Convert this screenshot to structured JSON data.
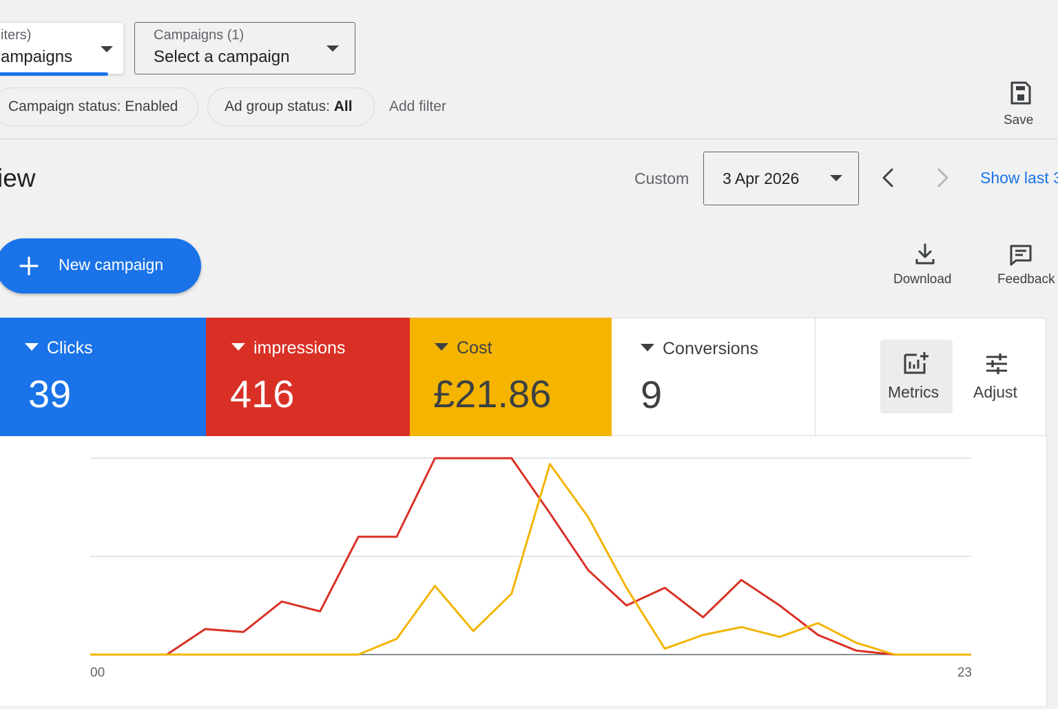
{
  "filters": {
    "view_selector": {
      "label": "iters)",
      "value": "ampaigns"
    },
    "campaign_selector": {
      "label": "Campaigns (1)",
      "value": "Select a campaign"
    },
    "chips": [
      {
        "text": "Campaign status: Enabled"
      },
      {
        "prefix": "Ad group status: ",
        "bold": "All"
      }
    ],
    "add_filter": "Add filter",
    "save_label": "Save"
  },
  "header": {
    "page_title": "iew",
    "date_range_label": "Custom",
    "date_value": "3 Apr 2026",
    "show_last": "Show last 3"
  },
  "actions": {
    "new_campaign": "New campaign",
    "download": "Download",
    "feedback": "Feedback"
  },
  "scorecards": [
    {
      "label": "Clicks",
      "value": "39",
      "color": "#1a73e8"
    },
    {
      "label": "impressions",
      "value": "416",
      "color": "#d93025"
    },
    {
      "label": "Cost",
      "value": "£21.86",
      "color": "#f4b400"
    },
    {
      "label": "Conversions",
      "value": "9",
      "color": "#ffffff"
    }
  ],
  "scorecard_tools": {
    "metrics": "Metrics",
    "adjust": "Adjust"
  },
  "chart_data": {
    "type": "line",
    "x_start_label": "00",
    "x_end_label": "23",
    "x": [
      0,
      1,
      2,
      3,
      4,
      5,
      6,
      7,
      8,
      9,
      10,
      11,
      12,
      13,
      14,
      15,
      16,
      17,
      18,
      19,
      20,
      21,
      22,
      23
    ],
    "ylim": [
      0,
      1
    ],
    "grid": true,
    "series": [
      {
        "color": "#d93025",
        "values": [
          0,
          0,
          0,
          0.13,
          0.115,
          0.27,
          0.22,
          0.6,
          0.6,
          1,
          1,
          1,
          0.72,
          0.43,
          0.25,
          0.34,
          0.19,
          0.38,
          0.25,
          0.1,
          0.02,
          0,
          0,
          0
        ]
      },
      {
        "color": "#f4b400",
        "values": [
          0,
          0,
          0,
          0,
          0,
          0,
          0,
          0,
          0.08,
          0.35,
          0.12,
          0.31,
          0.97,
          0.7,
          0.34,
          0.03,
          0.1,
          0.14,
          0.09,
          0.16,
          0.06,
          0,
          0,
          0
        ]
      }
    ]
  }
}
